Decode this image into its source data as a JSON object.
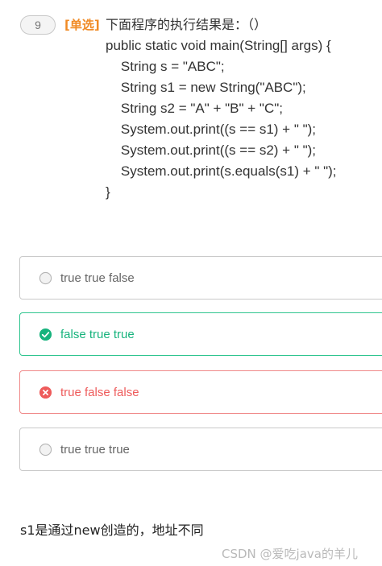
{
  "question": {
    "number": "9",
    "type_label": "[单选]",
    "title": "下面程序的执行结果是：（）",
    "code_lines": [
      "public static void main(String[] args) {",
      "    String s = \"ABC\";",
      "    String s1 = new String(\"ABC\");",
      "    String s2 = \"A\" + \"B\" + \"C\";",
      "    System.out.print((s == s1) + \" \");",
      "    System.out.print((s == s2) + \" \");",
      "    System.out.print(s.equals(s1) + \" \");",
      "}"
    ]
  },
  "options": [
    {
      "text": "true true false",
      "state": "unselected"
    },
    {
      "text": "false true true",
      "state": "correct"
    },
    {
      "text": "true false false",
      "state": "wrong"
    },
    {
      "text": "true true true",
      "state": "unselected"
    }
  ],
  "explanation": "s1是通过new创造的，地址不同",
  "watermark": "CSDN @爱吃java的羊儿",
  "colors": {
    "type_label": "#f08a24",
    "correct": "#2fc58f",
    "wrong": "#f06060",
    "neutral_border": "#c9c9c9"
  },
  "icons": {
    "unselected": "radio-empty-icon",
    "correct": "check-circle-icon",
    "wrong": "x-circle-icon"
  }
}
